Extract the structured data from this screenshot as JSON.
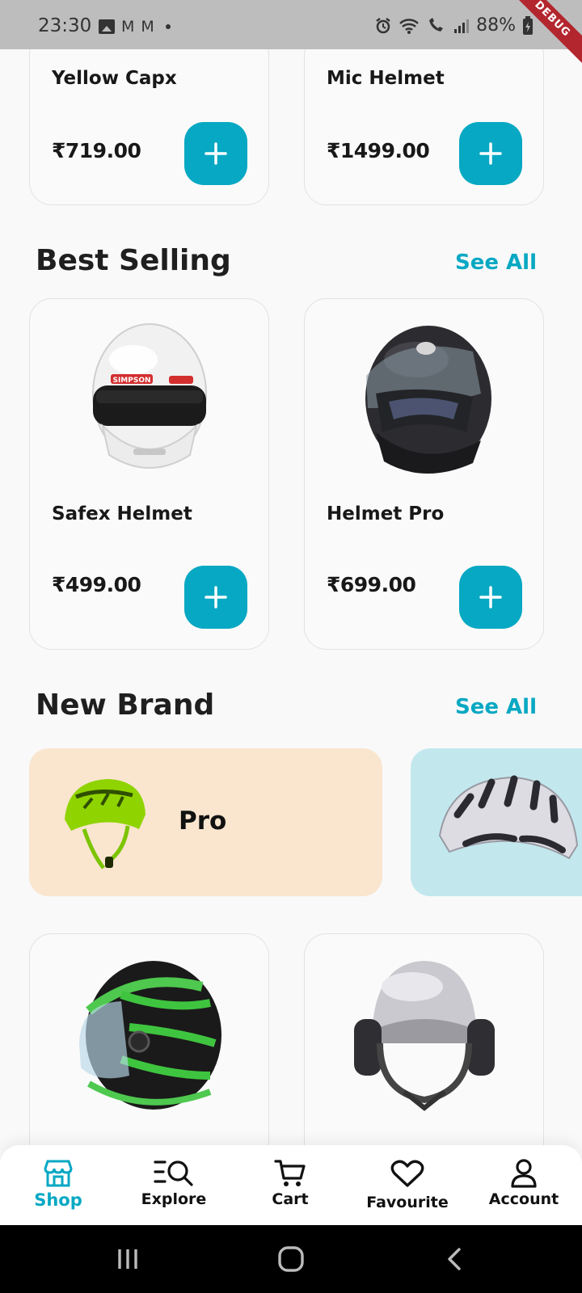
{
  "status_bar": {
    "time": "23:30",
    "m1": "M",
    "m2": "M",
    "battery": "88%",
    "debug_banner": "DEBUG"
  },
  "top_cards": [
    {
      "name": "Yellow Capx",
      "price": "₹719.00"
    },
    {
      "name": "Mic Helmet",
      "price": "₹1499.00"
    }
  ],
  "best_selling": {
    "title": "Best Selling",
    "see_all": "See All",
    "products": [
      {
        "name": "Safex Helmet",
        "price": "₹499.00",
        "image": "white-full-face-helmet",
        "image_text": "SIMPSON"
      },
      {
        "name": "Helmet Pro",
        "price": "₹699.00",
        "image": "black-full-face-helmet"
      }
    ]
  },
  "new_brand": {
    "title": "New Brand",
    "see_all": "See All",
    "brands": [
      {
        "label": "Pro",
        "color": "#fae5cf",
        "image": "green-bicycle-helmet"
      },
      {
        "label": "",
        "color": "#c2e8ee",
        "image": "white-bicycle-helmet"
      }
    ]
  },
  "bottom_row_images": [
    "green-black-full-face-helmet",
    "grey-open-helmet-with-headphones"
  ],
  "bottom_nav": {
    "items": [
      {
        "label": "Shop",
        "icon": "store-icon",
        "active": true
      },
      {
        "label": "Explore",
        "icon": "explore-search-icon",
        "active": false
      },
      {
        "label": "Cart",
        "icon": "cart-icon",
        "active": false
      },
      {
        "label": "Favourite",
        "icon": "heart-icon",
        "active": false
      },
      {
        "label": "Account",
        "icon": "user-icon",
        "active": false
      }
    ]
  },
  "colors": {
    "accent": "#07a8c3",
    "background": "#f9f9f9",
    "card_border": "#e2e2e2"
  }
}
